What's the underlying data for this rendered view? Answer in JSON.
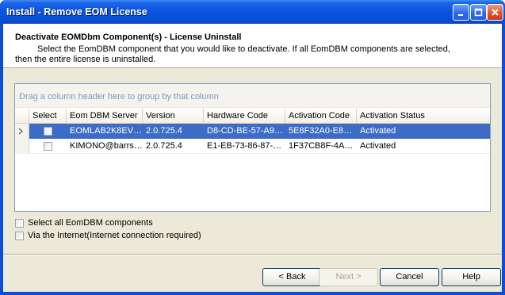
{
  "window": {
    "title": "Install - Remove EOM License"
  },
  "header": {
    "title": "Deactivate EOMDbm Component(s) - License Uninstall",
    "description": "Select the EomDBM component that you would like to deactivate.  If all EomDBM components are selected,  then the entire license is uninstalled."
  },
  "grid": {
    "group_hint": "Drag a column header here to group by that column",
    "columns": [
      "Select",
      "Eom DBM Server",
      "Version",
      "Hardware Code",
      "Activation Code",
      "Activation Status"
    ],
    "rows": [
      {
        "server": "EOMLAB2K8EVO...",
        "version": "2.0.725.4",
        "hardware": "D8-CD-BE-57-A9-8D...",
        "activation": "5E8F32A0-E8203...",
        "status": "Activated",
        "checked": false,
        "selected": true
      },
      {
        "server": "KIMONO@barrsys...",
        "version": "2.0.725.4",
        "hardware": "E1-EB-73-86-87-8D-...",
        "activation": "1F37CB8F-4AEC...",
        "status": "Activated",
        "checked": false,
        "selected": false
      }
    ]
  },
  "options": {
    "select_all": "Select all EomDBM components",
    "internet": "Via the Internet(Internet connection required)"
  },
  "buttons": {
    "back": "< Back",
    "next": "Next >",
    "cancel": "Cancel",
    "help": "Help"
  }
}
